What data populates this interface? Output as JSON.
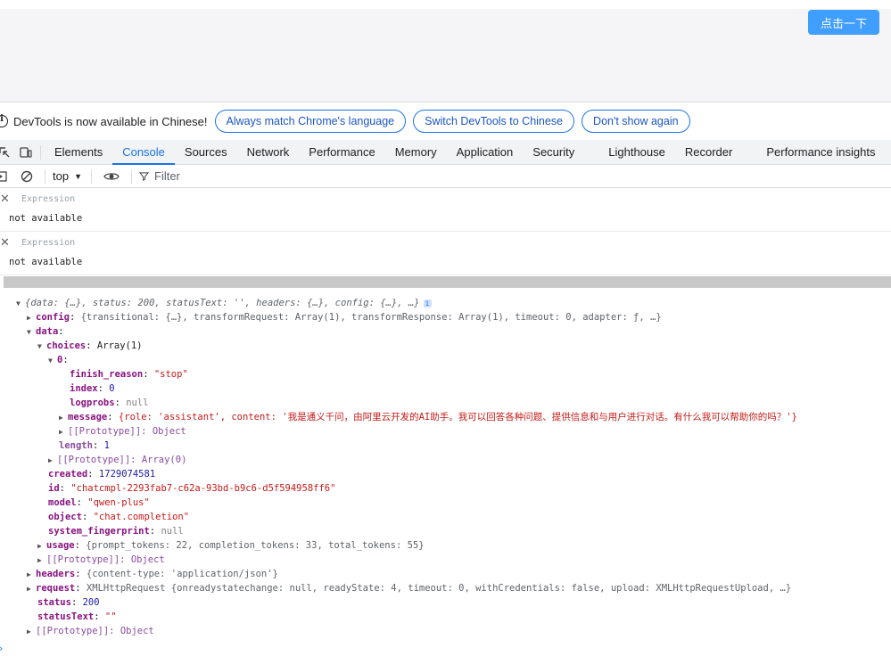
{
  "page": {
    "button_label": "点击一下"
  },
  "infobar": {
    "message": "DevTools is now available in Chinese!",
    "btn_match": "Always match Chrome's language",
    "btn_switch": "Switch DevTools to Chinese",
    "btn_dont": "Don't show again"
  },
  "tabs": [
    "Elements",
    "Console",
    "Sources",
    "Network",
    "Performance",
    "Memory",
    "Application",
    "Security",
    "Lighthouse",
    "Recorder",
    "Performance insights"
  ],
  "toolbar": {
    "context": "top",
    "filter_placeholder": "Filter"
  },
  "live_expressions": [
    {
      "label": "Expression",
      "value": "not available"
    },
    {
      "label": "Expression",
      "value": "not available"
    }
  ],
  "console": {
    "summary": "{data: {…}, status: 200, statusText: '', headers: {…}, config: {…}, …}",
    "config_key": "config",
    "config_val": "{transitional: {…}, transformRequest: Array(1), transformResponse: Array(1), timeout: 0, adapter: ƒ, …}",
    "data_key": "data",
    "choices_key": "choices",
    "choices_val": "Array(1)",
    "index0_key": "0",
    "finish_reason_key": "finish_reason",
    "finish_reason_val": "\"stop\"",
    "index_key": "index",
    "index_val": "0",
    "logprobs_key": "logprobs",
    "logprobs_val": "null",
    "message_key": "message",
    "message_val": "{role: 'assistant', content: '我是通义千问，由阿里云开发的AI助手。我可以回答各种问题、提供信息和与用户进行对话。有什么我可以帮助你的吗？'}",
    "proto_obj": "[[Prototype]]: Object",
    "length_key": "length",
    "length_val": "1",
    "proto_arr": "[[Prototype]]: Array(0)",
    "created_key": "created",
    "created_val": "1729074581",
    "id_key": "id",
    "id_val": "\"chatcmpl-2293fab7-c62a-93bd-b9c6-d5f594958ff6\"",
    "model_key": "model",
    "model_val": "\"qwen-plus\"",
    "object_key": "object",
    "object_val": "\"chat.completion\"",
    "sysfp_key": "system_fingerprint",
    "sysfp_val": "null",
    "usage_key": "usage",
    "usage_val": "{prompt_tokens: 22, completion_tokens: 33, total_tokens: 55}",
    "headers_key": "headers",
    "headers_val": "{content-type: 'application/json'}",
    "request_key": "request",
    "request_val": "XMLHttpRequest {onreadystatechange: null, readyState: 4, timeout: 0, withCredentials: false, upload: XMLHttpRequestUpload, …}",
    "status_key": "status",
    "status_val": "200",
    "statusText_key": "statusText",
    "statusText_val": "\"\""
  }
}
